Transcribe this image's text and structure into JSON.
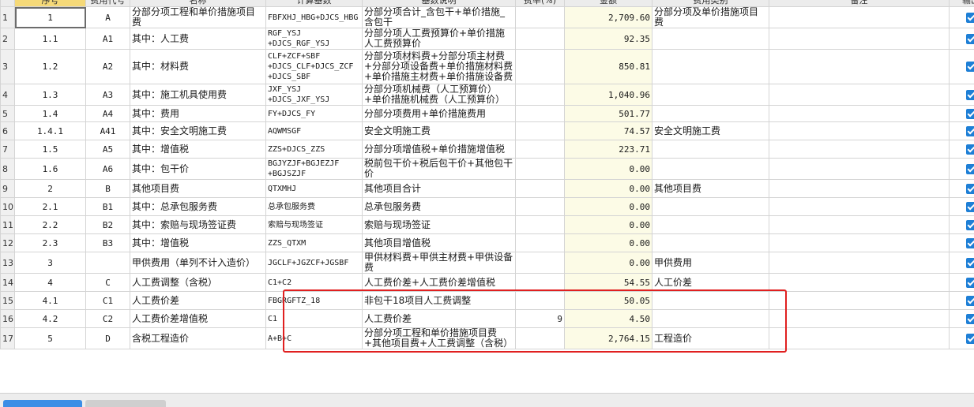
{
  "columns": {
    "no": "序号",
    "code": "费用代号",
    "name": "名称",
    "base": "计算基数",
    "base_desc": "基数说明",
    "rate": "费率(%)",
    "amount": "金额",
    "type": "费用类别",
    "remark": "备注",
    "print": "输出"
  },
  "rows": [
    {
      "row": "1",
      "no": "1",
      "code": "A",
      "name": "分部分项工程和单价措施项目费",
      "base": "FBFXHJ_HBG+DJCS_HBG",
      "desc": "分部分项合计_含包干+单价措施_含包干",
      "rate": "",
      "amount": "2,709.60",
      "type": "分部分项及单价措施项目费",
      "remark": "",
      "print": true
    },
    {
      "row": "2",
      "no": "1.1",
      "code": "A1",
      "name": "其中：人工费",
      "base": "RGF_YSJ\n+DJCS_RGF_YSJ",
      "desc": "分部分项人工费预算价+单价措施人工费预算价",
      "rate": "",
      "amount": "92.35",
      "type": "",
      "remark": "",
      "print": true
    },
    {
      "row": "3",
      "no": "1.2",
      "code": "A2",
      "name": "其中：材料费",
      "base": "CLF+ZCF+SBF\n+DJCS_CLF+DJCS_ZCF\n+DJCS_SBF",
      "desc": "分部分项材料费+分部分项主材费+分部分项设备费+单价措施材料费+单价措施主材费+单价措施设备费",
      "rate": "",
      "amount": "850.81",
      "type": "",
      "remark": "",
      "print": true
    },
    {
      "row": "4",
      "no": "1.3",
      "code": "A3",
      "name": "其中：施工机具使用费",
      "base": "JXF_YSJ\n+DJCS_JXF_YSJ",
      "desc": "分部分项机械费（人工预算价）+单价措施机械费（人工预算价）",
      "rate": "",
      "amount": "1,040.96",
      "type": "",
      "remark": "",
      "print": true
    },
    {
      "row": "5",
      "no": "1.4",
      "code": "A4",
      "name": "其中：费用",
      "base": "FY+DJCS_FY",
      "desc": "分部分项费用+单价措施费用",
      "rate": "",
      "amount": "501.77",
      "type": "",
      "remark": "",
      "print": true
    },
    {
      "row": "6",
      "no": "1.4.1",
      "code": "A41",
      "name": "其中：安全文明施工费",
      "base": "AQWMSGF",
      "desc": "安全文明施工费",
      "rate": "",
      "amount": "74.57",
      "type": "安全文明施工费",
      "remark": "",
      "print": true
    },
    {
      "row": "7",
      "no": "1.5",
      "code": "A5",
      "name": "其中：增值税",
      "base": "ZZS+DJCS_ZZS",
      "desc": "分部分项增值税+单价措施增值税",
      "rate": "",
      "amount": "223.71",
      "type": "",
      "remark": "",
      "print": true
    },
    {
      "row": "8",
      "no": "1.6",
      "code": "A6",
      "name": "其中：包干价",
      "base": "BGJYZJF+BGJEZJF\n+BGJSZJF",
      "desc": "税前包干价+税后包干价+其他包干价",
      "rate": "",
      "amount": "0.00",
      "type": "",
      "remark": "",
      "print": true
    },
    {
      "row": "9",
      "no": "2",
      "code": "B",
      "name": "其他项目费",
      "base": "QTXMHJ",
      "desc": "其他项目合计",
      "rate": "",
      "amount": "0.00",
      "type": "其他项目费",
      "remark": "",
      "print": true
    },
    {
      "row": "10",
      "no": "2.1",
      "code": "B1",
      "name": "其中：总承包服务费",
      "base": "总承包服务费",
      "desc": "总承包服务费",
      "rate": "",
      "amount": "0.00",
      "type": "",
      "remark": "",
      "print": true
    },
    {
      "row": "11",
      "no": "2.2",
      "code": "B2",
      "name": "其中：索赔与现场签证费",
      "base": "索赔与现场签证",
      "desc": "索赔与现场签证",
      "rate": "",
      "amount": "0.00",
      "type": "",
      "remark": "",
      "print": true
    },
    {
      "row": "12",
      "no": "2.3",
      "code": "B3",
      "name": "其中：增值税",
      "base": "ZZS_QTXM",
      "desc": "其他项目增值税",
      "rate": "",
      "amount": "0.00",
      "type": "",
      "remark": "",
      "print": true
    },
    {
      "row": "13",
      "no": "3",
      "code": "",
      "name": "甲供费用（单列不计入造价）",
      "base": "JGCLF+JGZCF+JGSBF",
      "desc": "甲供材料费+甲供主材费+甲供设备费",
      "rate": "",
      "amount": "0.00",
      "type": "甲供费用",
      "remark": "",
      "print": true
    },
    {
      "row": "14",
      "no": "4",
      "code": "C",
      "name": "人工费调整（含税）",
      "base": "C1+C2",
      "desc": "人工费价差+人工费价差增值税",
      "rate": "",
      "amount": "54.55",
      "type": "人工价差",
      "remark": "",
      "print": true
    },
    {
      "row": "15",
      "no": "4.1",
      "code": "C1",
      "name": "人工费价差",
      "base": "FBGRGFTZ_18",
      "desc": "非包干18项目人工费调整",
      "rate": "",
      "amount": "50.05",
      "type": "",
      "remark": "",
      "print": true
    },
    {
      "row": "16",
      "no": "4.2",
      "code": "C2",
      "name": "人工费价差增值税",
      "base": "C1",
      "desc": "人工费价差",
      "rate": "9",
      "amount": "4.50",
      "type": "",
      "remark": "",
      "print": true
    },
    {
      "row": "17",
      "no": "5",
      "code": "D",
      "name": "含税工程造价",
      "base": "A+B+C",
      "desc": "分部分项工程和单价措施项目费+其他项目费+人工费调整（含税）",
      "rate": "",
      "amount": "2,764.15",
      "type": "工程造价",
      "remark": "",
      "print": true
    }
  ],
  "colors": {
    "checkbox": "#1e7fd6",
    "amount_bg": "#fcfbe6",
    "highlight_box": "#e02020",
    "header_selected": "#f5d978"
  }
}
